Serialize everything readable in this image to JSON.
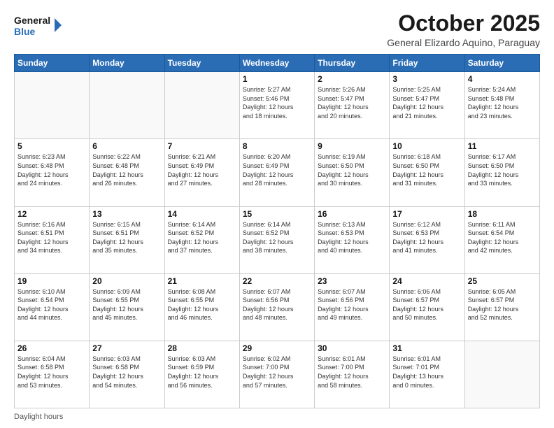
{
  "header": {
    "logo_line1": "General",
    "logo_line2": "Blue",
    "month_title": "October 2025",
    "location": "General Elizardo Aquino, Paraguay"
  },
  "days_of_week": [
    "Sunday",
    "Monday",
    "Tuesday",
    "Wednesday",
    "Thursday",
    "Friday",
    "Saturday"
  ],
  "weeks": [
    [
      {
        "day": "",
        "info": ""
      },
      {
        "day": "",
        "info": ""
      },
      {
        "day": "",
        "info": ""
      },
      {
        "day": "1",
        "info": "Sunrise: 5:27 AM\nSunset: 5:46 PM\nDaylight: 12 hours\nand 18 minutes."
      },
      {
        "day": "2",
        "info": "Sunrise: 5:26 AM\nSunset: 5:47 PM\nDaylight: 12 hours\nand 20 minutes."
      },
      {
        "day": "3",
        "info": "Sunrise: 5:25 AM\nSunset: 5:47 PM\nDaylight: 12 hours\nand 21 minutes."
      },
      {
        "day": "4",
        "info": "Sunrise: 5:24 AM\nSunset: 5:48 PM\nDaylight: 12 hours\nand 23 minutes."
      }
    ],
    [
      {
        "day": "5",
        "info": "Sunrise: 6:23 AM\nSunset: 6:48 PM\nDaylight: 12 hours\nand 24 minutes."
      },
      {
        "day": "6",
        "info": "Sunrise: 6:22 AM\nSunset: 6:48 PM\nDaylight: 12 hours\nand 26 minutes."
      },
      {
        "day": "7",
        "info": "Sunrise: 6:21 AM\nSunset: 6:49 PM\nDaylight: 12 hours\nand 27 minutes."
      },
      {
        "day": "8",
        "info": "Sunrise: 6:20 AM\nSunset: 6:49 PM\nDaylight: 12 hours\nand 28 minutes."
      },
      {
        "day": "9",
        "info": "Sunrise: 6:19 AM\nSunset: 6:50 PM\nDaylight: 12 hours\nand 30 minutes."
      },
      {
        "day": "10",
        "info": "Sunrise: 6:18 AM\nSunset: 6:50 PM\nDaylight: 12 hours\nand 31 minutes."
      },
      {
        "day": "11",
        "info": "Sunrise: 6:17 AM\nSunset: 6:50 PM\nDaylight: 12 hours\nand 33 minutes."
      }
    ],
    [
      {
        "day": "12",
        "info": "Sunrise: 6:16 AM\nSunset: 6:51 PM\nDaylight: 12 hours\nand 34 minutes."
      },
      {
        "day": "13",
        "info": "Sunrise: 6:15 AM\nSunset: 6:51 PM\nDaylight: 12 hours\nand 35 minutes."
      },
      {
        "day": "14",
        "info": "Sunrise: 6:14 AM\nSunset: 6:52 PM\nDaylight: 12 hours\nand 37 minutes."
      },
      {
        "day": "15",
        "info": "Sunrise: 6:14 AM\nSunset: 6:52 PM\nDaylight: 12 hours\nand 38 minutes."
      },
      {
        "day": "16",
        "info": "Sunrise: 6:13 AM\nSunset: 6:53 PM\nDaylight: 12 hours\nand 40 minutes."
      },
      {
        "day": "17",
        "info": "Sunrise: 6:12 AM\nSunset: 6:53 PM\nDaylight: 12 hours\nand 41 minutes."
      },
      {
        "day": "18",
        "info": "Sunrise: 6:11 AM\nSunset: 6:54 PM\nDaylight: 12 hours\nand 42 minutes."
      }
    ],
    [
      {
        "day": "19",
        "info": "Sunrise: 6:10 AM\nSunset: 6:54 PM\nDaylight: 12 hours\nand 44 minutes."
      },
      {
        "day": "20",
        "info": "Sunrise: 6:09 AM\nSunset: 6:55 PM\nDaylight: 12 hours\nand 45 minutes."
      },
      {
        "day": "21",
        "info": "Sunrise: 6:08 AM\nSunset: 6:55 PM\nDaylight: 12 hours\nand 46 minutes."
      },
      {
        "day": "22",
        "info": "Sunrise: 6:07 AM\nSunset: 6:56 PM\nDaylight: 12 hours\nand 48 minutes."
      },
      {
        "day": "23",
        "info": "Sunrise: 6:07 AM\nSunset: 6:56 PM\nDaylight: 12 hours\nand 49 minutes."
      },
      {
        "day": "24",
        "info": "Sunrise: 6:06 AM\nSunset: 6:57 PM\nDaylight: 12 hours\nand 50 minutes."
      },
      {
        "day": "25",
        "info": "Sunrise: 6:05 AM\nSunset: 6:57 PM\nDaylight: 12 hours\nand 52 minutes."
      }
    ],
    [
      {
        "day": "26",
        "info": "Sunrise: 6:04 AM\nSunset: 6:58 PM\nDaylight: 12 hours\nand 53 minutes."
      },
      {
        "day": "27",
        "info": "Sunrise: 6:03 AM\nSunset: 6:58 PM\nDaylight: 12 hours\nand 54 minutes."
      },
      {
        "day": "28",
        "info": "Sunrise: 6:03 AM\nSunset: 6:59 PM\nDaylight: 12 hours\nand 56 minutes."
      },
      {
        "day": "29",
        "info": "Sunrise: 6:02 AM\nSunset: 7:00 PM\nDaylight: 12 hours\nand 57 minutes."
      },
      {
        "day": "30",
        "info": "Sunrise: 6:01 AM\nSunset: 7:00 PM\nDaylight: 12 hours\nand 58 minutes."
      },
      {
        "day": "31",
        "info": "Sunrise: 6:01 AM\nSunset: 7:01 PM\nDaylight: 13 hours\nand 0 minutes."
      },
      {
        "day": "",
        "info": ""
      }
    ]
  ],
  "footer": {
    "text": "Daylight hours"
  }
}
